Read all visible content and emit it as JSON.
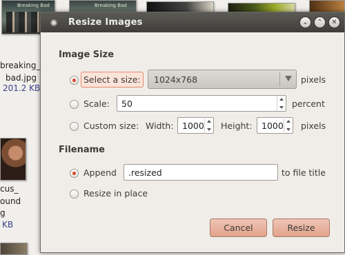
{
  "background": {
    "files": [
      {
        "name_line1": "breaking_",
        "name_line2": "bad.jpg",
        "size": "201.2 KB",
        "thumb_title": "Breaking Bad"
      },
      {
        "thumb_title": "Breaking Bad"
      },
      {
        "name_line1": "cus_",
        "name_line2": "ound",
        "name_line3": "g",
        "size": "KB"
      }
    ]
  },
  "dialog": {
    "title": "Resize Images",
    "image_size": {
      "heading": "Image Size",
      "select_label": "Select a size:",
      "select_value": "1024x768",
      "select_unit": "pixels",
      "scale_label": "Scale:",
      "scale_value": "50",
      "scale_unit": "percent",
      "custom_label": "Custom size:",
      "width_label": "Width:",
      "width_value": "1000",
      "height_label": "Height:",
      "height_value": "1000",
      "custom_unit": "pixels",
      "selected_option": "select"
    },
    "filename": {
      "heading": "Filename",
      "append_label": "Append",
      "append_value": ".resized",
      "append_suffix": "to file title",
      "inplace_label": "Resize in place",
      "selected_option": "append"
    },
    "buttons": {
      "cancel": "Cancel",
      "resize": "Resize"
    }
  },
  "colors": {
    "accent": "#d9472b",
    "button": "#e2a38c",
    "titlebar": "#3f3e3b"
  }
}
